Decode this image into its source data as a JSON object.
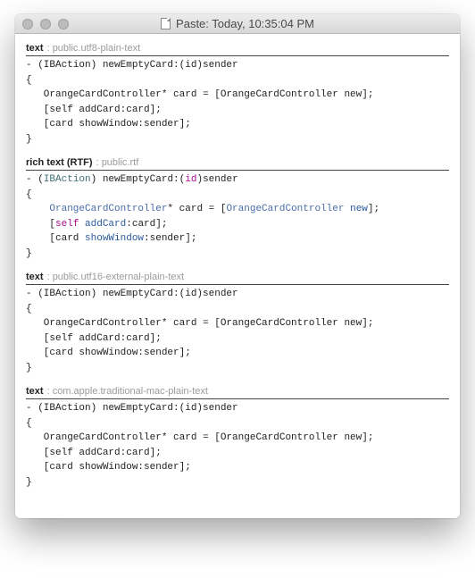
{
  "window": {
    "title": "Paste: Today, 10:35:04 PM"
  },
  "sections": [
    {
      "label": "text",
      "type": "public.utf8-plain-text",
      "syntax": false,
      "code": {
        "sig_prefix": "- (IBAction) newEmptyCard:(id)sender",
        "open_brace": "{",
        "line1": "   OrangeCardController* card = [OrangeCardController new];",
        "line2": "   [self addCard:card];",
        "line3": "   [card showWindow:sender];",
        "close_brace": "}"
      }
    },
    {
      "label": "rich text (RTF)",
      "type": "public.rtf",
      "syntax": true,
      "code": {
        "sig_ret": "IBAction",
        "sig_name": " newEmptyCard:(",
        "sig_idtype": "id",
        "sig_after": ")sender",
        "open_brace": "{",
        "class": "OrangeCardController",
        "l1_mid": "* card = [",
        "l1_new": "new",
        "l1_end": "];",
        "l2_self": "self",
        "l2_addCard": "addCard",
        "l2_end": ":card];",
        "l3_showWindow": "showWindow",
        "l3_end": ":sender];",
        "close_brace": "}"
      }
    },
    {
      "label": "text",
      "type": "public.utf16-external-plain-text",
      "syntax": false,
      "code": {
        "sig_prefix": "- (IBAction) newEmptyCard:(id)sender",
        "open_brace": "{",
        "line1": "   OrangeCardController* card = [OrangeCardController new];",
        "line2": "   [self addCard:card];",
        "line3": "   [card showWindow:sender];",
        "close_brace": "}"
      }
    },
    {
      "label": "text",
      "type": "com.apple.traditional-mac-plain-text",
      "syntax": false,
      "code": {
        "sig_prefix": "- (IBAction) newEmptyCard:(id)sender",
        "open_brace": "{",
        "line1": "   OrangeCardController* card = [OrangeCardController new];",
        "line2": "   [self addCard:card];",
        "line3": "   [card showWindow:sender];",
        "close_brace": "}"
      }
    }
  ]
}
